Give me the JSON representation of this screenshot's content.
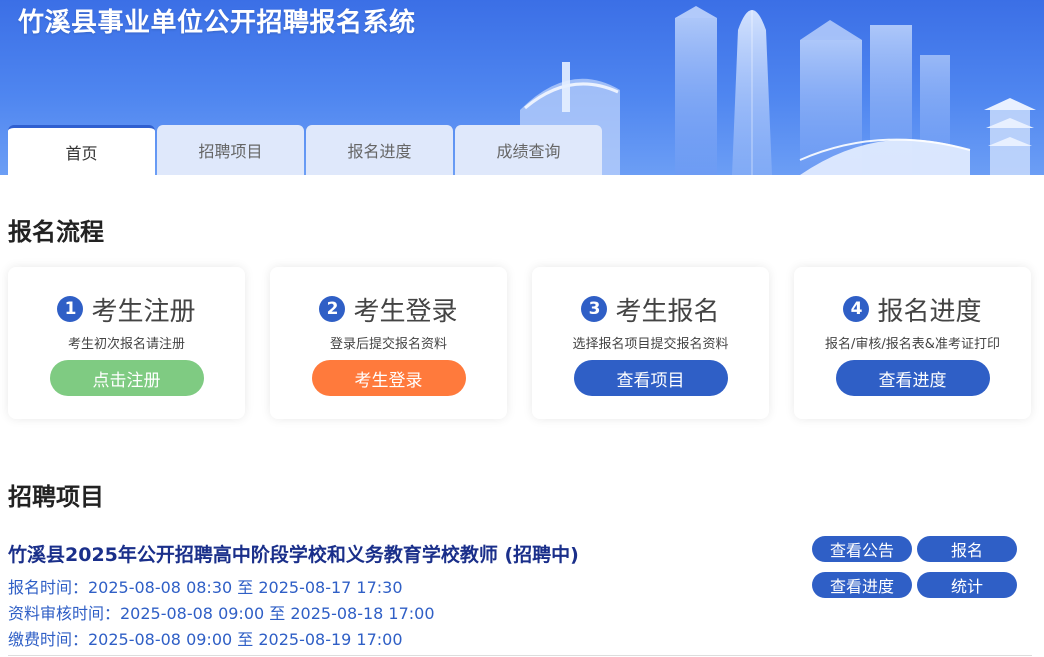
{
  "header": {
    "title": "竹溪县事业单位公开招聘报名系统"
  },
  "tabs": [
    {
      "label": "首页",
      "active": true
    },
    {
      "label": "招聘项目",
      "active": false
    },
    {
      "label": "报名进度",
      "active": false
    },
    {
      "label": "成绩查询",
      "active": false
    }
  ],
  "process": {
    "heading": "报名流程",
    "steps": [
      {
        "num": "1",
        "title": "考生注册",
        "desc": "考生初次报名请注册",
        "button": "点击注册",
        "button_color": "#7fcb82"
      },
      {
        "num": "2",
        "title": "考生登录",
        "desc": "登录后提交报名资料",
        "button": "考生登录",
        "button_color": "#ff7a3c"
      },
      {
        "num": "3",
        "title": "考生报名",
        "desc": "选择报名项目提交报名资料",
        "button": "查看项目",
        "button_color": "#2f5fc6"
      },
      {
        "num": "4",
        "title": "报名进度",
        "desc": "报名/审核/报名表&准考证打印",
        "button": "查看进度",
        "button_color": "#2f5fc6"
      }
    ]
  },
  "projects": {
    "heading": "招聘项目",
    "items": [
      {
        "title": "竹溪县2025年公开招聘高中阶段学校和义务教育学校教师 (招聘中)",
        "lines": [
          "报名时间：2025-08-08 08:30 至 2025-08-17 17:30",
          "资料审核时间：2025-08-08 09:00 至 2025-08-18 17:00",
          "缴费时间：2025-08-08 09:00 至 2025-08-19 17:00"
        ],
        "buttons": {
          "notice": "查看公告",
          "apply": "报名",
          "progress": "查看进度",
          "stats": "统计"
        }
      }
    ]
  },
  "colors": {
    "primary": "#2f5fc6",
    "banner": "#3b6fe6",
    "green": "#7fcb82",
    "orange": "#ff7a3c"
  }
}
